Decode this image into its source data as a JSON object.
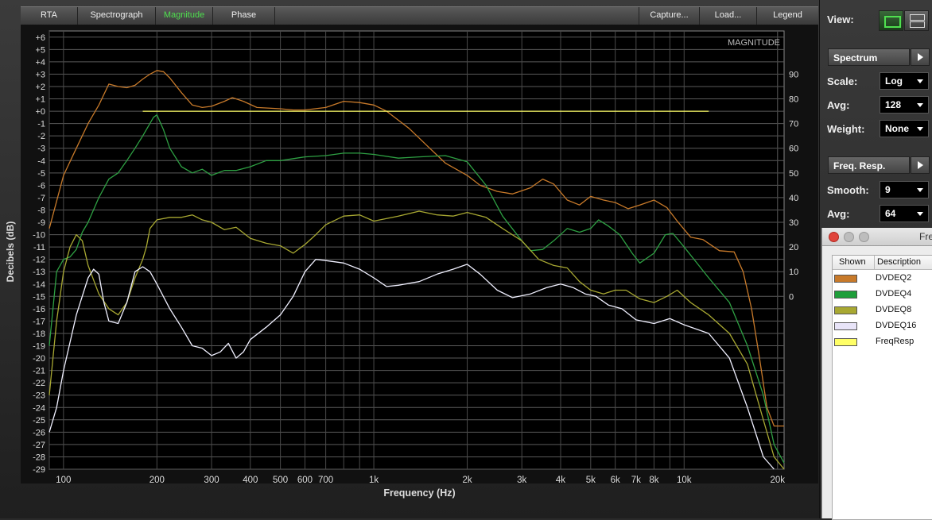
{
  "tabs": {
    "rta": "RTA",
    "spectrograph": "Spectrograph",
    "magnitude": "Magnitude",
    "phase": "Phase",
    "capture": "Capture...",
    "load": "Load...",
    "legend": "Legend"
  },
  "plot": {
    "overlay_title": "MAGNITUDE"
  },
  "chart_data": {
    "type": "line",
    "title": "",
    "xlabel": "Frequency (Hz)",
    "ylabel": "Decibels (dB)",
    "x_scale": "log",
    "xlim": [
      90,
      21000
    ],
    "ylim": [
      -29,
      6.5
    ],
    "y_ticks_left": [
      "+6",
      "+5",
      "+4",
      "+3",
      "+2",
      "+1",
      "+0",
      "-1",
      "-2",
      "-3",
      "-4",
      "-5",
      "-6",
      "-7",
      "-8",
      "-9",
      "-10",
      "-11",
      "-12",
      "-13",
      "-14",
      "-15",
      "-16",
      "-17",
      "-18",
      "-19",
      "-20",
      "-21",
      "-22",
      "-23",
      "-24",
      "-25",
      "-26",
      "-27",
      "-28",
      "-29"
    ],
    "y_ticks_right": [
      "90",
      "80",
      "70",
      "60",
      "50",
      "40",
      "30",
      "20",
      "10",
      "0"
    ],
    "x_ticks": [
      "100",
      "200",
      "300",
      "400",
      "500",
      "600",
      "700",
      "1k",
      "2k",
      "3k",
      "4k",
      "5k",
      "6k",
      "7k",
      "8k",
      "10k",
      "20k"
    ],
    "grid": true,
    "legend_position": "separate window",
    "series": [
      {
        "name": "DVDEQ2",
        "color": "#c87a2a",
        "points": [
          [
            90,
            -9.5
          ],
          [
            100,
            -5.2
          ],
          [
            110,
            -3
          ],
          [
            120,
            -1
          ],
          [
            130,
            0.5
          ],
          [
            140,
            2.2
          ],
          [
            150,
            2
          ],
          [
            160,
            1.9
          ],
          [
            170,
            2.1
          ],
          [
            180,
            2.6
          ],
          [
            190,
            3
          ],
          [
            200,
            3.3
          ],
          [
            210,
            3.2
          ],
          [
            220,
            2.7
          ],
          [
            240,
            1.5
          ],
          [
            260,
            0.5
          ],
          [
            280,
            0.3
          ],
          [
            300,
            0.4
          ],
          [
            330,
            0.8
          ],
          [
            350,
            1.1
          ],
          [
            380,
            0.8
          ],
          [
            420,
            0.3
          ],
          [
            500,
            0.2
          ],
          [
            550,
            0.1
          ],
          [
            600,
            0.1
          ],
          [
            700,
            0.3
          ],
          [
            800,
            0.8
          ],
          [
            900,
            0.7
          ],
          [
            1000,
            0.5
          ],
          [
            1100,
            0
          ],
          [
            1300,
            -1.4
          ],
          [
            1500,
            -2.9
          ],
          [
            1700,
            -4.2
          ],
          [
            2000,
            -5.2
          ],
          [
            2200,
            -6
          ],
          [
            2500,
            -6.5
          ],
          [
            2800,
            -6.7
          ],
          [
            3200,
            -6.2
          ],
          [
            3500,
            -5.5
          ],
          [
            3800,
            -5.9
          ],
          [
            4200,
            -7.2
          ],
          [
            4600,
            -7.6
          ],
          [
            5000,
            -6.9
          ],
          [
            5500,
            -7.2
          ],
          [
            6000,
            -7.4
          ],
          [
            6600,
            -7.9
          ],
          [
            7200,
            -7.6
          ],
          [
            8000,
            -7.2
          ],
          [
            8800,
            -7.8
          ],
          [
            9500,
            -8.9
          ],
          [
            10500,
            -10.2
          ],
          [
            11500,
            -10.4
          ],
          [
            13000,
            -11.3
          ],
          [
            14500,
            -11.4
          ],
          [
            15500,
            -13
          ],
          [
            16500,
            -16
          ],
          [
            17500,
            -20
          ],
          [
            18500,
            -24
          ],
          [
            19500,
            -25.5
          ],
          [
            21000,
            -25.5
          ]
        ]
      },
      {
        "name": "DVDEQ4",
        "color": "#2ea043",
        "points": [
          [
            90,
            -19
          ],
          [
            95,
            -13
          ],
          [
            100,
            -12
          ],
          [
            105,
            -11.8
          ],
          [
            110,
            -11.2
          ],
          [
            115,
            -9.8
          ],
          [
            120,
            -9
          ],
          [
            130,
            -7
          ],
          [
            140,
            -5.5
          ],
          [
            150,
            -5
          ],
          [
            160,
            -4
          ],
          [
            170,
            -3
          ],
          [
            180,
            -2
          ],
          [
            195,
            -0.5
          ],
          [
            200,
            -0.3
          ],
          [
            210,
            -1.5
          ],
          [
            220,
            -3
          ],
          [
            240,
            -4.5
          ],
          [
            260,
            -5
          ],
          [
            280,
            -4.7
          ],
          [
            300,
            -5.2
          ],
          [
            330,
            -4.8
          ],
          [
            360,
            -4.8
          ],
          [
            400,
            -4.5
          ],
          [
            450,
            -4
          ],
          [
            500,
            -4
          ],
          [
            600,
            -3.7
          ],
          [
            700,
            -3.6
          ],
          [
            800,
            -3.4
          ],
          [
            900,
            -3.4
          ],
          [
            1000,
            -3.5
          ],
          [
            1200,
            -3.8
          ],
          [
            1400,
            -3.7
          ],
          [
            1700,
            -3.6
          ],
          [
            2000,
            -4.1
          ],
          [
            2300,
            -6
          ],
          [
            2600,
            -8.5
          ],
          [
            3000,
            -10.5
          ],
          [
            3200,
            -11.3
          ],
          [
            3500,
            -11.2
          ],
          [
            3800,
            -10.5
          ],
          [
            4200,
            -9.5
          ],
          [
            4600,
            -9.8
          ],
          [
            5000,
            -9.5
          ],
          [
            5300,
            -8.8
          ],
          [
            5700,
            -9.3
          ],
          [
            6200,
            -10
          ],
          [
            6800,
            -11.5
          ],
          [
            7200,
            -12.3
          ],
          [
            8000,
            -11.5
          ],
          [
            8700,
            -10
          ],
          [
            9200,
            -9.9
          ],
          [
            10000,
            -11
          ],
          [
            12000,
            -13.5
          ],
          [
            14000,
            -15.5
          ],
          [
            16000,
            -19
          ],
          [
            18000,
            -23
          ],
          [
            19500,
            -27
          ],
          [
            21000,
            -28.5
          ]
        ]
      },
      {
        "name": "DVDEQ8",
        "color": "#a8a832",
        "points": [
          [
            90,
            -23
          ],
          [
            95,
            -17
          ],
          [
            100,
            -13
          ],
          [
            105,
            -11
          ],
          [
            110,
            -10
          ],
          [
            115,
            -10.5
          ],
          [
            120,
            -12.5
          ],
          [
            130,
            -14.8
          ],
          [
            140,
            -16
          ],
          [
            150,
            -16.5
          ],
          [
            160,
            -15.5
          ],
          [
            170,
            -13.5
          ],
          [
            180,
            -12
          ],
          [
            185,
            -11
          ],
          [
            190,
            -9.5
          ],
          [
            200,
            -8.8
          ],
          [
            220,
            -8.6
          ],
          [
            240,
            -8.6
          ],
          [
            260,
            -8.4
          ],
          [
            280,
            -8.8
          ],
          [
            300,
            -9
          ],
          [
            330,
            -9.6
          ],
          [
            360,
            -9.4
          ],
          [
            400,
            -10.3
          ],
          [
            450,
            -10.7
          ],
          [
            500,
            -10.9
          ],
          [
            550,
            -11.5
          ],
          [
            600,
            -10.8
          ],
          [
            650,
            -10
          ],
          [
            700,
            -9.2
          ],
          [
            800,
            -8.5
          ],
          [
            900,
            -8.4
          ],
          [
            1000,
            -8.9
          ],
          [
            1200,
            -8.5
          ],
          [
            1400,
            -8.1
          ],
          [
            1600,
            -8.4
          ],
          [
            1800,
            -8.5
          ],
          [
            2000,
            -8.2
          ],
          [
            2300,
            -8.6
          ],
          [
            2600,
            -9.5
          ],
          [
            3000,
            -10.5
          ],
          [
            3400,
            -12
          ],
          [
            3800,
            -12.5
          ],
          [
            4200,
            -12.7
          ],
          [
            4600,
            -13.8
          ],
          [
            5000,
            -14.5
          ],
          [
            5500,
            -14.8
          ],
          [
            6000,
            -14.5
          ],
          [
            6500,
            -14.5
          ],
          [
            7200,
            -15.2
          ],
          [
            8000,
            -15.5
          ],
          [
            8800,
            -15
          ],
          [
            9500,
            -14.5
          ],
          [
            10500,
            -15.5
          ],
          [
            12000,
            -16.5
          ],
          [
            14000,
            -18
          ],
          [
            16000,
            -20.5
          ],
          [
            18000,
            -25
          ],
          [
            19500,
            -28
          ],
          [
            21000,
            -29
          ]
        ]
      },
      {
        "name": "DVDEQ16",
        "color": "#f0f0ff",
        "points": [
          [
            90,
            -26
          ],
          [
            95,
            -24
          ],
          [
            100,
            -21
          ],
          [
            110,
            -16.5
          ],
          [
            120,
            -13.5
          ],
          [
            125,
            -12.8
          ],
          [
            130,
            -13.2
          ],
          [
            135,
            -15.5
          ],
          [
            140,
            -17
          ],
          [
            150,
            -17.2
          ],
          [
            160,
            -15.5
          ],
          [
            170,
            -13
          ],
          [
            180,
            -12.6
          ],
          [
            190,
            -13
          ],
          [
            200,
            -14
          ],
          [
            220,
            -16
          ],
          [
            240,
            -17.5
          ],
          [
            260,
            -19
          ],
          [
            280,
            -19.2
          ],
          [
            300,
            -19.8
          ],
          [
            320,
            -19.5
          ],
          [
            340,
            -18.8
          ],
          [
            360,
            -20
          ],
          [
            380,
            -19.5
          ],
          [
            400,
            -18.5
          ],
          [
            450,
            -17.5
          ],
          [
            500,
            -16.5
          ],
          [
            550,
            -15
          ],
          [
            600,
            -13
          ],
          [
            650,
            -12
          ],
          [
            700,
            -12.1
          ],
          [
            800,
            -12.3
          ],
          [
            900,
            -12.8
          ],
          [
            1000,
            -13.5
          ],
          [
            1100,
            -14.2
          ],
          [
            1200,
            -14.1
          ],
          [
            1400,
            -13.8
          ],
          [
            1600,
            -13.2
          ],
          [
            1800,
            -12.8
          ],
          [
            2000,
            -12.4
          ],
          [
            2200,
            -13.2
          ],
          [
            2500,
            -14.5
          ],
          [
            2800,
            -15.1
          ],
          [
            3200,
            -14.8
          ],
          [
            3600,
            -14.3
          ],
          [
            4000,
            -14
          ],
          [
            4400,
            -14.3
          ],
          [
            4800,
            -14.8
          ],
          [
            5200,
            -15
          ],
          [
            5700,
            -15.7
          ],
          [
            6300,
            -16
          ],
          [
            7000,
            -16.9
          ],
          [
            8000,
            -17.2
          ],
          [
            9000,
            -16.8
          ],
          [
            10000,
            -17.3
          ],
          [
            12000,
            -18
          ],
          [
            14000,
            -20
          ],
          [
            16000,
            -24
          ],
          [
            18000,
            -28
          ],
          [
            19500,
            -30
          ]
        ]
      },
      {
        "name": "FreqResp",
        "color": "#ffff66",
        "points": [
          [
            180,
            0
          ],
          [
            12000,
            0
          ]
        ]
      }
    ]
  },
  "right_panel": {
    "view_label": "View:",
    "spectrum_label": "Spectrum",
    "scale_label": "Scale:",
    "scale_value": "Log",
    "avg_label": "Avg:",
    "avg_value": "128",
    "weight_label": "Weight:",
    "weight_value": "None",
    "freqresp_label": "Freq. Resp.",
    "smoothing_label": "Smooth:",
    "smoothing_value": "9",
    "avg2_label": "Avg:",
    "avg2_value": "64"
  },
  "legend_window": {
    "title": "Fre",
    "col_shown": "Shown",
    "col_desc": "Description",
    "items": [
      {
        "label": "DVDEQ2",
        "color": "#c87a2a"
      },
      {
        "label": "DVDEQ4",
        "color": "#1e9e3a"
      },
      {
        "label": "DVDEQ8",
        "color": "#a8a832"
      },
      {
        "label": "DVDEQ16",
        "color": "#e8e4f8"
      },
      {
        "label": "FreqResp",
        "color": "#ffff66"
      }
    ]
  }
}
